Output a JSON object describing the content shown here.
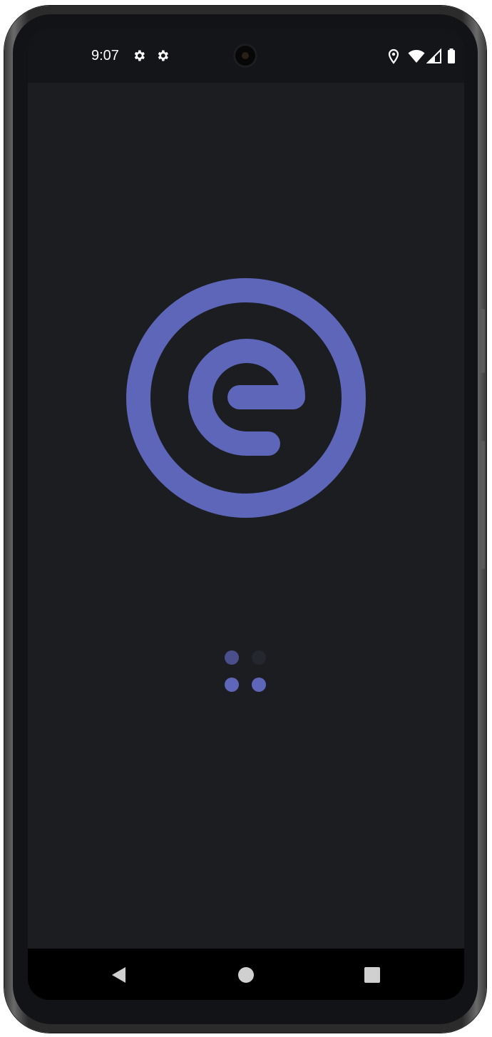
{
  "status_bar": {
    "time": "9:07",
    "icons": [
      "settings-icon",
      "settings-icon",
      "location-icon",
      "wifi-icon",
      "signal-icon",
      "battery-icon"
    ]
  },
  "splash": {
    "logo": "app-logo-e-in-circle",
    "loading_indicator": "loading-dots",
    "colors": {
      "background": "#1b1d21",
      "accent": "#5d66b8",
      "dot_dim": "#4a4f8c",
      "dot_faint": "#25272e"
    }
  },
  "navigation_bar": {
    "buttons": [
      "back-icon",
      "home-icon",
      "recents-icon"
    ]
  }
}
